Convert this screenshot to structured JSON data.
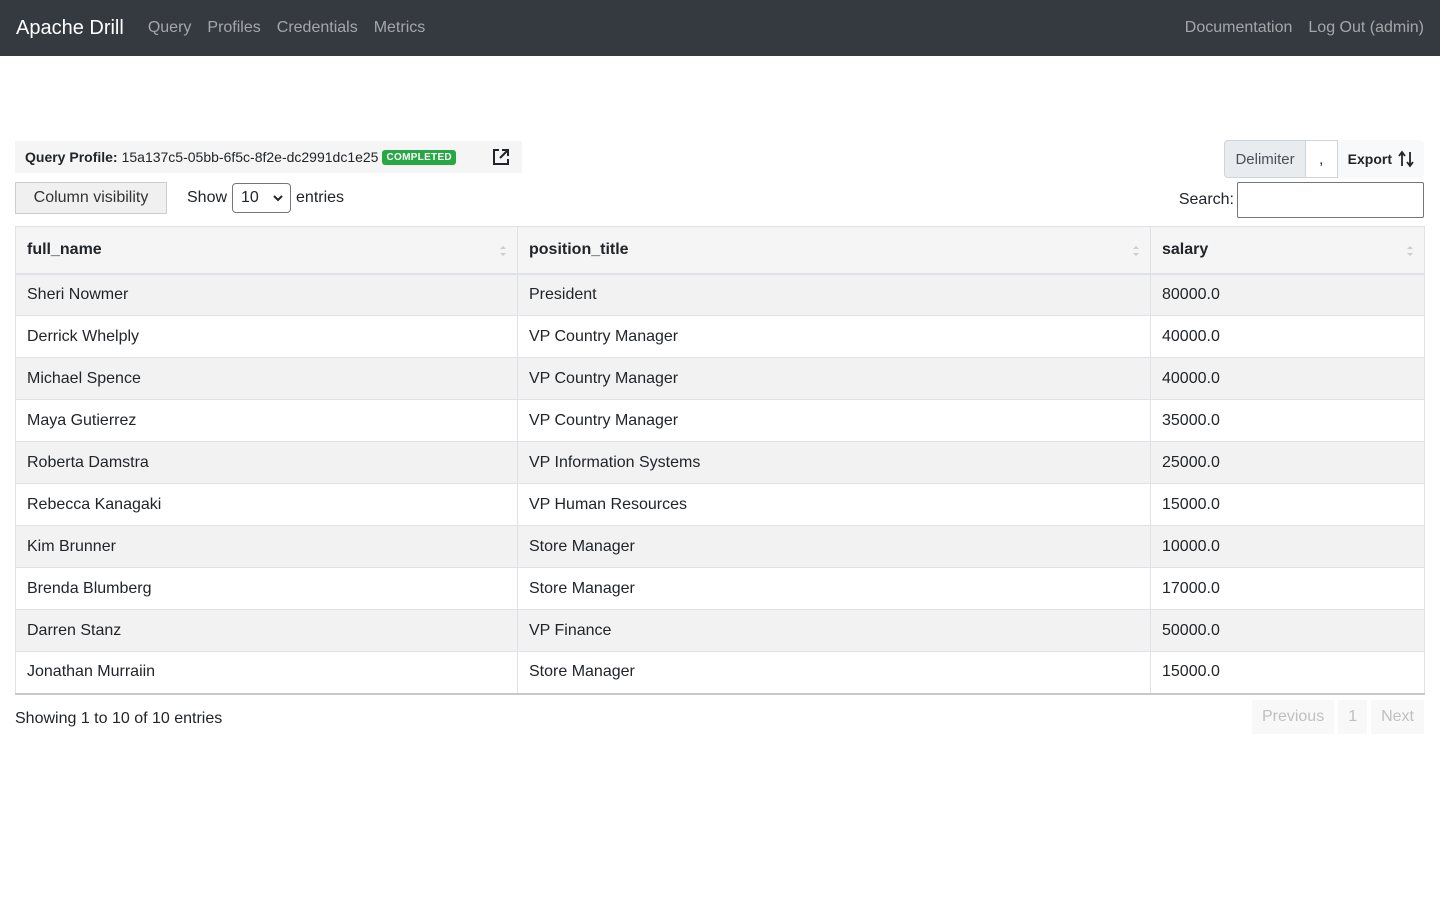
{
  "navbar": {
    "brand": "Apache Drill",
    "links": [
      "Query",
      "Profiles",
      "Credentials",
      "Metrics"
    ],
    "right_links": [
      "Documentation",
      "Log Out (admin)"
    ]
  },
  "profile": {
    "label": "Query Profile:",
    "id": "15a137c5-05bb-6f5c-8f2e-dc2991dc1e25",
    "status": "COMPLETED",
    "status_color": "#28a745"
  },
  "export": {
    "delimiter_label": "Delimiter",
    "delimiter_value": ",",
    "export_label": "Export"
  },
  "controls": {
    "column_visibility": "Column visibility",
    "show_label": "Show",
    "entries_value": "10",
    "entries_label": "entries",
    "search_label": "Search:"
  },
  "table": {
    "columns": [
      "full_name",
      "position_title",
      "salary"
    ],
    "rows": [
      [
        "Sheri Nowmer",
        "President",
        "80000.0"
      ],
      [
        "Derrick Whelply",
        "VP Country Manager",
        "40000.0"
      ],
      [
        "Michael Spence",
        "VP Country Manager",
        "40000.0"
      ],
      [
        "Maya Gutierrez",
        "VP Country Manager",
        "35000.0"
      ],
      [
        "Roberta Damstra",
        "VP Information Systems",
        "25000.0"
      ],
      [
        "Rebecca Kanagaki",
        "VP Human Resources",
        "15000.0"
      ],
      [
        "Kim Brunner",
        "Store Manager",
        "10000.0"
      ],
      [
        "Brenda Blumberg",
        "Store Manager",
        "17000.0"
      ],
      [
        "Darren Stanz",
        "VP Finance",
        "50000.0"
      ],
      [
        "Jonathan Murraiin",
        "Store Manager",
        "15000.0"
      ]
    ]
  },
  "footer": {
    "info": "Showing 1 to 10 of 10 entries",
    "previous": "Previous",
    "page": "1",
    "next": "Next"
  }
}
